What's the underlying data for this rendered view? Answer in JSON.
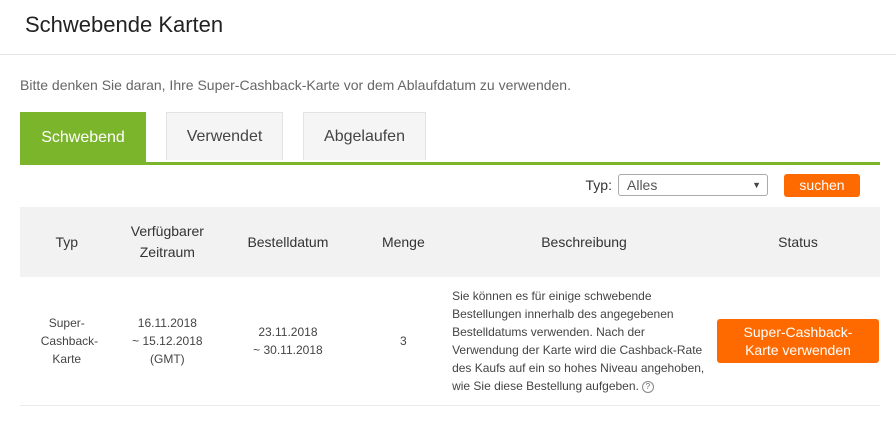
{
  "header": {
    "title": "Schwebende Karten"
  },
  "notice": "Bitte denken Sie daran, Ihre Super-Cashback-Karte vor dem Ablaufdatum zu verwenden.",
  "tabs": [
    {
      "label": "Schwebend",
      "active": true
    },
    {
      "label": "Verwendet",
      "active": false
    },
    {
      "label": "Abgelaufen",
      "active": false
    }
  ],
  "filter": {
    "type_label": "Typ:",
    "selected": "Alles",
    "search_label": "suchen"
  },
  "table": {
    "headers": {
      "type": "Typ",
      "period": "Verfügbarer Zeitraum",
      "order_date": "Bestelldatum",
      "quantity": "Menge",
      "description": "Beschreibung",
      "status": "Status"
    },
    "rows": [
      {
        "type": "Super-Cashback-Karte",
        "period_start": "16.11.2018",
        "period_end": "~ 15.12.2018 (GMT)",
        "order_start": "23.11.2018",
        "order_end": "~ 30.11.2018",
        "quantity": "3",
        "description": "Sie können es für einige schwebende Bestellungen innerhalb des angegebenen Bestelldatums verwenden. Nach der Verwendung der Karte wird die Cashback-Rate des Kaufs auf ein so hohes Niveau angehoben, wie Sie diese Bestellung aufgeben.",
        "help_icon": "?",
        "action_label": "Super-Cashback-Karte verwenden"
      }
    ]
  },
  "colors": {
    "accent_green": "#7ab52c",
    "action_orange": "#ff6a00"
  }
}
